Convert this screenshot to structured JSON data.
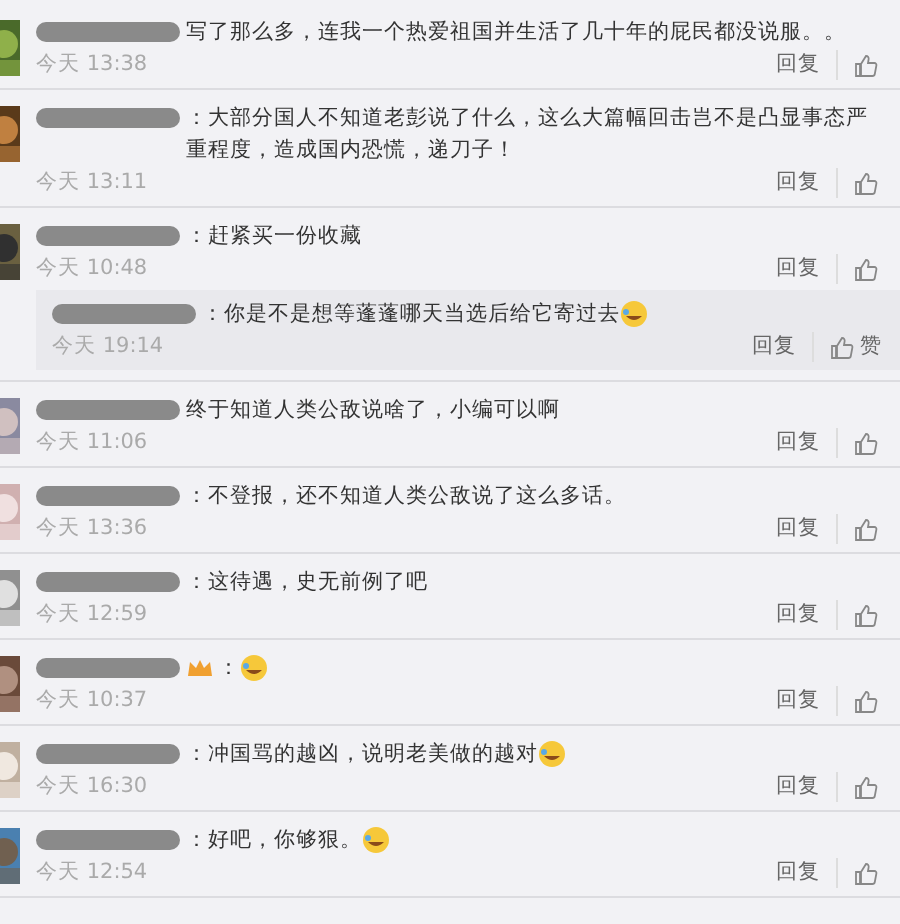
{
  "comments": [
    {
      "text": "写了那么多，连我一个热爱祖国并生活了几十年的屁民都没说服。。",
      "time": "今天 13:38",
      "reply_label": "回复"
    },
    {
      "text": "：大部分国人不知道老彭说了什么，这么大篇幅回击岂不是凸显事态严重程度，造成国内恐慌，递刀子！",
      "time": "今天 13:11",
      "reply_label": "回复"
    },
    {
      "text": "：赶紧买一份收藏",
      "time": "今天 10:48",
      "reply_label": "回复",
      "replies": [
        {
          "text": "：你是不是想等蓬蓬哪天当选后给它寄过去",
          "time": "今天 19:14",
          "reply_label": "回复",
          "likes": "赞",
          "emoji": true
        }
      ]
    },
    {
      "text": "终于知道人类公敌说啥了，小编可以啊",
      "time": "今天 11:06",
      "reply_label": "回复"
    },
    {
      "text": "：不登报，还不知道人类公敌说了这么多话。",
      "time": "今天 13:36",
      "reply_label": "回复"
    },
    {
      "text": "：这待遇，史无前例了吧",
      "time": "今天 12:59",
      "reply_label": "回复"
    },
    {
      "text": "：",
      "time": "今天 10:37",
      "reply_label": "回复",
      "badge": true,
      "emoji": true
    },
    {
      "text": "：冲国骂的越凶，说明老美做的越对",
      "time": "今天 16:30",
      "reply_label": "回复",
      "emoji": true
    },
    {
      "text": "：好吧，你够狠。",
      "time": "今天 12:54",
      "reply_label": "回复",
      "emoji": true
    }
  ]
}
